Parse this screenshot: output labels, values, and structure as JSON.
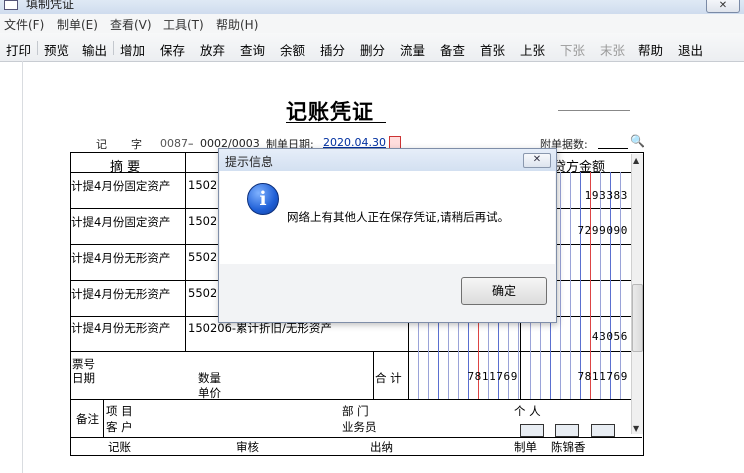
{
  "window": {
    "title": "填制凭证",
    "close_label": "✕"
  },
  "menubar": [
    "文件(F)",
    "制单(E)",
    "查看(V)",
    "工具(T)",
    "帮助(H)"
  ],
  "toolbar": [
    {
      "label": "打印",
      "enabled": true
    },
    {
      "label": "预览",
      "enabled": true
    },
    {
      "label": "输出",
      "enabled": true
    },
    {
      "label": "增加",
      "enabled": true
    },
    {
      "label": "保存",
      "enabled": true
    },
    {
      "label": "放弃",
      "enabled": true
    },
    {
      "label": "查询",
      "enabled": true
    },
    {
      "label": "余额",
      "enabled": true
    },
    {
      "label": "插分",
      "enabled": true
    },
    {
      "label": "删分",
      "enabled": true
    },
    {
      "label": "流量",
      "enabled": true
    },
    {
      "label": "备查",
      "enabled": true
    },
    {
      "label": "首张",
      "enabled": true
    },
    {
      "label": "上张",
      "enabled": true
    },
    {
      "label": "下张",
      "enabled": false
    },
    {
      "label": "末张",
      "enabled": false
    },
    {
      "label": "帮助",
      "enabled": true
    },
    {
      "label": "退出",
      "enabled": true
    }
  ],
  "voucher": {
    "title": "记账凭证",
    "word_label": "记",
    "zi_label": "字",
    "number": "0087",
    "sub_number": "0002/0003",
    "date_label": "制单日期:",
    "date_value": "2020.04.30",
    "attach_label": "附单据数:",
    "col_summary": "摘  要",
    "col_credit": "贷方金额",
    "rows": [
      {
        "summary": "计提4月份固定资产",
        "account": "15020",
        "debit": "",
        "credit": "193383"
      },
      {
        "summary": "计提4月份固定资产",
        "account": "15020",
        "debit": "",
        "credit": "7299090"
      },
      {
        "summary": "计提4月份无形资产",
        "account": "55020",
        "debit": "",
        "credit": ""
      },
      {
        "summary": "计提4月份无形资产",
        "account": "55020",
        "debit": "",
        "credit": ""
      },
      {
        "summary": "计提4月份无形资产",
        "account": "150206-累计折旧/无形资产",
        "debit": "",
        "credit": "43056"
      }
    ],
    "ticket_label": "票号",
    "date_row_label": "日期",
    "qty_label": "数量",
    "price_label": "单价",
    "total_label": "合 计",
    "total_debit": "7811769",
    "total_credit": "7811769",
    "note_label": "备注",
    "project_label": "项  目",
    "dept_label": "部  门",
    "person_label": "个  人",
    "customer_label": "客  户",
    "clerk_label": "业务员",
    "sign_bookkeep": "记账",
    "sign_audit": "审核",
    "sign_cashier": "出纳",
    "sign_maker": "制单",
    "maker_name": "陈锦香"
  },
  "dialog": {
    "title": "提示信息",
    "close_label": "✕",
    "message": "网络上有其他人正在保存凭证,请稍后再试。",
    "ok_label": "确定"
  }
}
